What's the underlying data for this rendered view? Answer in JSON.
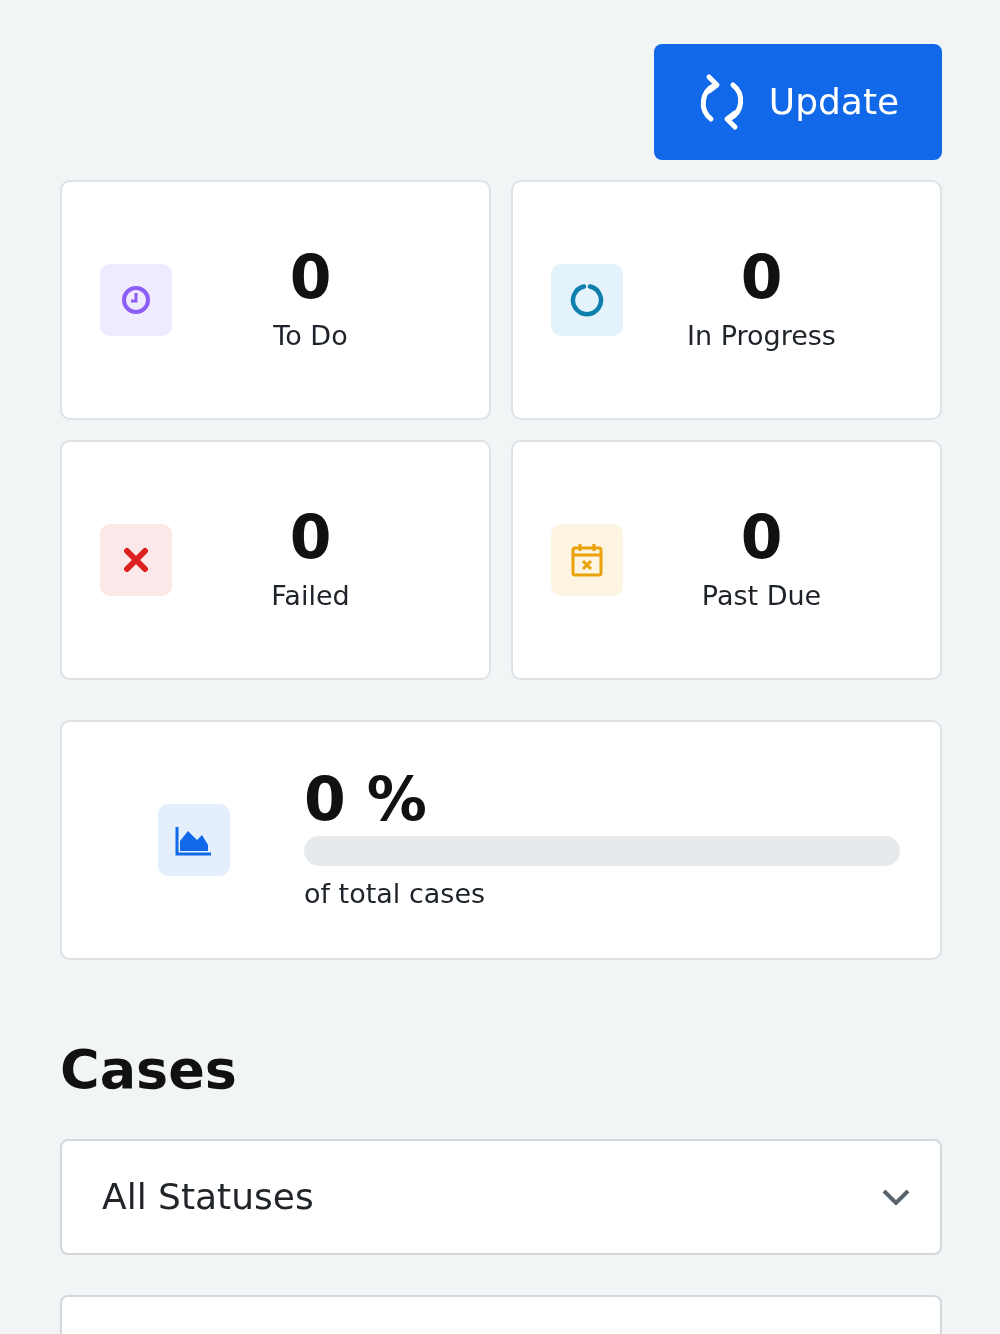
{
  "update_button": {
    "label": "Update"
  },
  "stats": [
    {
      "kind": "todo",
      "value": "0",
      "label": "To Do"
    },
    {
      "kind": "progress",
      "value": "0",
      "label": "In Progress"
    },
    {
      "kind": "failed",
      "value": "0",
      "label": "Failed"
    },
    {
      "kind": "pastdue",
      "value": "0",
      "label": "Past Due"
    }
  ],
  "completion": {
    "value": "0 %",
    "level": 0,
    "caption": "of total cases"
  },
  "cases": {
    "title": "Cases",
    "filters": [
      {
        "kind": "select",
        "value": "All Statuses"
      },
      {
        "kind": "blank"
      }
    ]
  }
}
